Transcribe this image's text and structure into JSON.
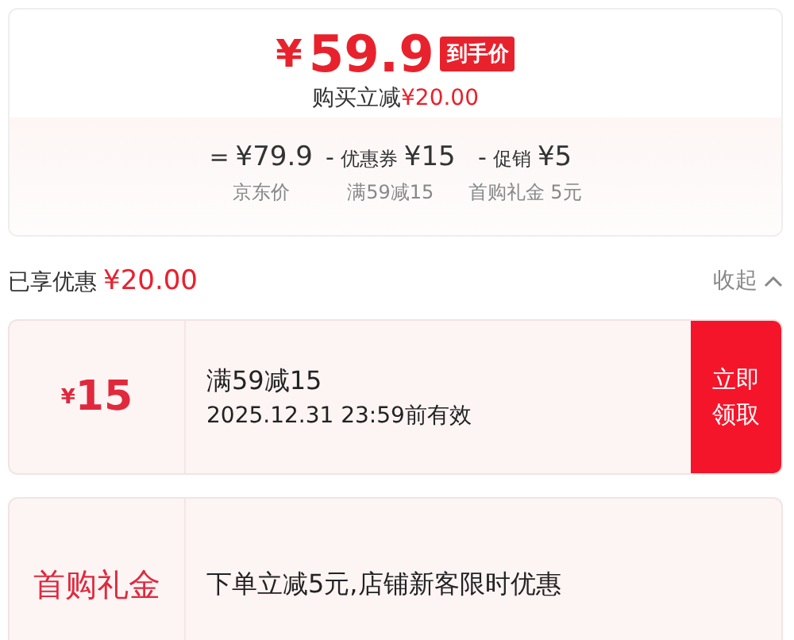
{
  "summary": {
    "currency": "¥",
    "price": "59.9",
    "price_tag": "到手价",
    "saving_label": "购买立减",
    "saving_amount": "¥20.00",
    "breakdown": [
      {
        "kind": "eq",
        "sign": "=",
        "amount": "¥79.9",
        "caption": "京东价"
      },
      {
        "kind": "minus",
        "sign": "-",
        "label": "优惠券",
        "amount": "¥15",
        "caption": "满59减15"
      },
      {
        "kind": "minus",
        "sign": "-",
        "label": "促销",
        "amount": "¥5",
        "caption": "首购礼金 5元"
      }
    ]
  },
  "benefits": {
    "title": "已享优惠",
    "amount": "¥20.00",
    "toggle": "收起",
    "expanded": true
  },
  "offers": [
    {
      "kind": "coupon",
      "currency": "¥",
      "value": "15",
      "title": "满59减15",
      "validity": "2025.12.31 23:59前有效",
      "action": "立即领取"
    },
    {
      "kind": "gift",
      "label": "首购礼金",
      "title": "下单立减5元,店铺新客限时优惠"
    }
  ]
}
